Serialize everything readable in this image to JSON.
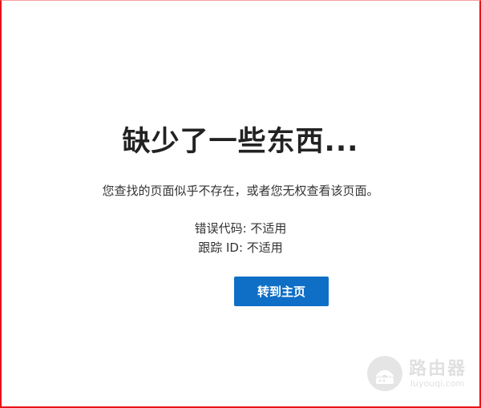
{
  "error_page": {
    "title": "缺少了一些东西...",
    "message": "您查找的页面似乎不存在，或者您无权查看该页面。",
    "error_code": "错误代码: 不适用",
    "trace_id": "跟踪 ID: 不适用",
    "home_button_label": "转到主页"
  },
  "watermark": {
    "text": "路由器",
    "url": "luyouqi.com"
  },
  "colors": {
    "frame_border": "#e8141b",
    "button_bg": "#0f6fc6",
    "button_text": "#ffffff",
    "title_text": "#222222"
  }
}
